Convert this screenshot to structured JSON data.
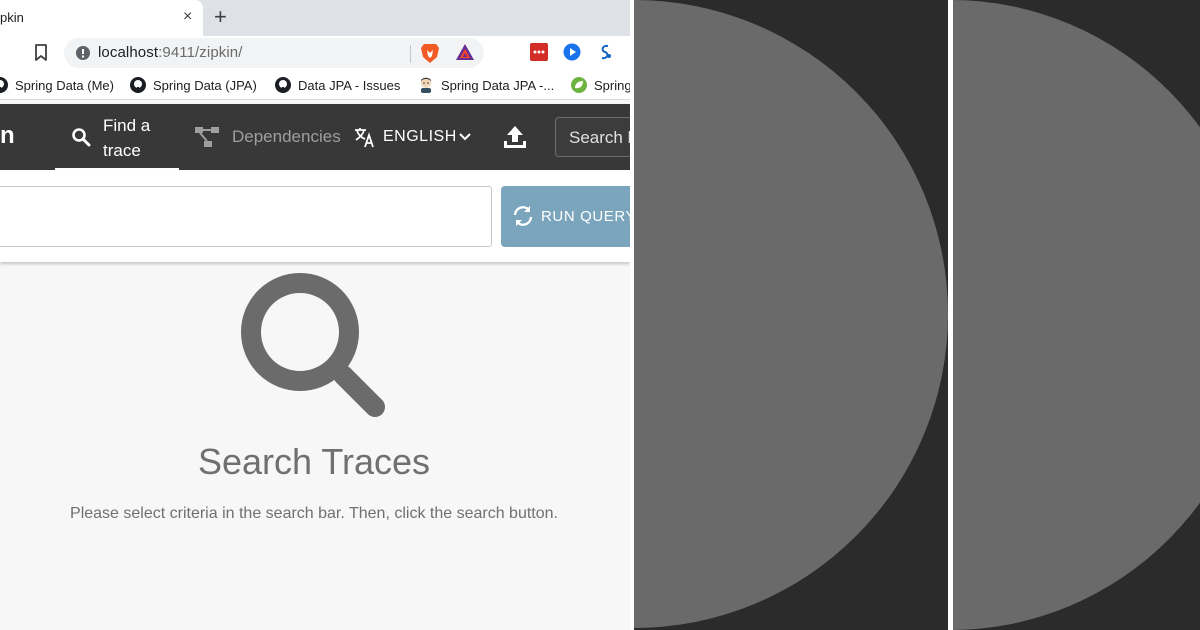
{
  "browser": {
    "tab_title": "pkin",
    "tab_close_glyph": "×",
    "new_tab_glyph": "+",
    "url_host": "localhost",
    "url_path": ":9411/zipkin/",
    "icons": [
      "bookmark-icon",
      "info-icon",
      "brave-lion-icon",
      "bat-triangle-icon",
      "lastpass-icon",
      "extension-play-icon",
      "extension-s-icon"
    ]
  },
  "bookmarks": [
    {
      "label": "Spring Data (Me)",
      "icon": "github-icon"
    },
    {
      "label": "Spring Data (JPA)",
      "icon": "github-icon"
    },
    {
      "label": "Data JPA - Issues",
      "icon": "github-icon"
    },
    {
      "label": "Spring Data JPA -...",
      "icon": "jenkins-icon"
    },
    {
      "label": "Spring",
      "icon": "spring-leaf-icon"
    }
  ],
  "zipkin": {
    "brand_fragment": "n",
    "nav": {
      "find_a_trace": "Find a trace",
      "dependencies": "Dependencies"
    },
    "language": "ENGLISH",
    "trace_search_placeholder": "Search b",
    "run_query": "RUN QUERY"
  },
  "empty_state": {
    "title": "Search Traces",
    "description": "Please select criteria in the search bar. Then, click the search button."
  },
  "colors": {
    "header_bg": "#383838",
    "run_query_bg": "#7aa5bd",
    "empty_icon": "#6b6b6b",
    "panel_bg": "#2b2b2b",
    "panel_circle": "#6a6a6a"
  }
}
